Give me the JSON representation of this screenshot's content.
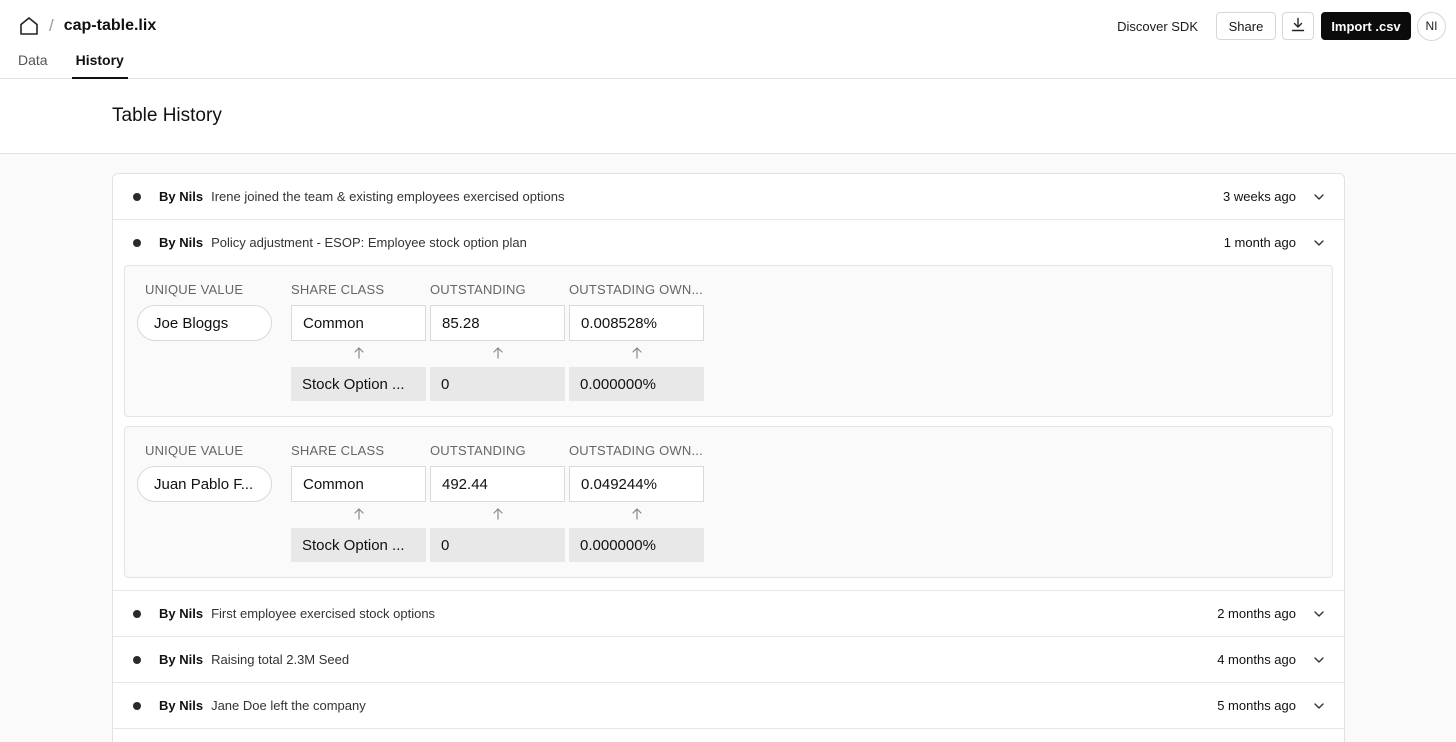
{
  "header": {
    "breadcrumb_sep": "/",
    "file_name": "cap-table.lix",
    "discover_label": "Discover SDK",
    "share_label": "Share",
    "import_label": "Import .csv",
    "avatar_initials": "NI"
  },
  "tabs": [
    {
      "label": "Data",
      "active": false
    },
    {
      "label": "History",
      "active": true
    }
  ],
  "page_title": "Table History",
  "columns": {
    "unique_value": "UNIQUE VALUE",
    "share_class": "SHARE CLASS",
    "outstanding": "OUTSTANDING",
    "ownership": "OUTSTADING OWN..."
  },
  "entries": [
    {
      "author": "By Nils",
      "message": "Irene joined the team & existing employees exercised options",
      "time": "3 weeks ago",
      "expanded": false
    },
    {
      "author": "By Nils",
      "message": "Policy adjustment - ESOP: Employee stock option plan",
      "time": "1 month ago",
      "expanded": true,
      "changes": [
        {
          "unique": "Joe Bloggs",
          "share_class": "Common",
          "outstanding": "85.28",
          "ownership": "0.008528%",
          "prev_share_class": "Stock Option ...",
          "prev_outstanding": "0",
          "prev_ownership": "0.000000%"
        },
        {
          "unique": "Juan Pablo F...",
          "share_class": "Common",
          "outstanding": "492.44",
          "ownership": "0.049244%",
          "prev_share_class": "Stock Option ...",
          "prev_outstanding": "0",
          "prev_ownership": "0.000000%"
        }
      ]
    },
    {
      "author": "By Nils",
      "message": "First employee exercised stock options",
      "time": "2 months ago",
      "expanded": false
    },
    {
      "author": "By Nils",
      "message": "Raising total 2.3M Seed",
      "time": "4 months ago",
      "expanded": false
    },
    {
      "author": "By Nils",
      "message": "Jane Doe left the company",
      "time": "5 months ago",
      "expanded": false
    }
  ],
  "icons": {
    "home": "home-icon",
    "download": "download-icon",
    "chevron": "chevron-down-icon",
    "arrow": "arrow-up-icon"
  }
}
